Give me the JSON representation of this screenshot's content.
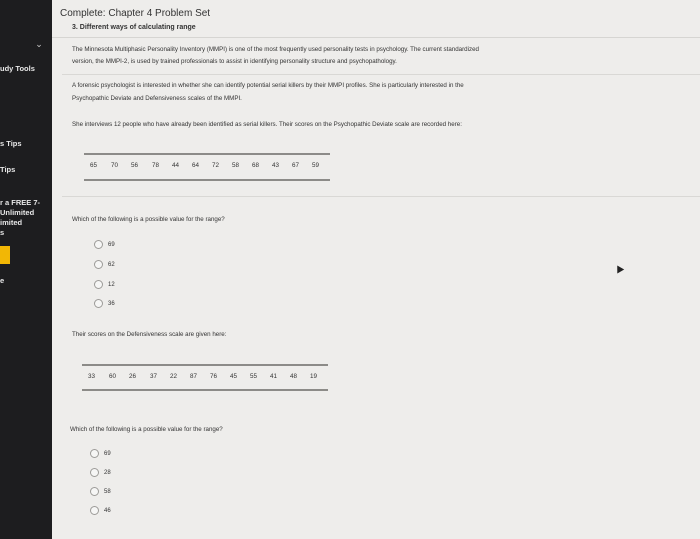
{
  "sidebar": {
    "items": [
      {
        "label": "udy Tools"
      },
      {
        "label": "s Tips"
      },
      {
        "label": "Tips"
      },
      {
        "label": "r a FREE 7-"
      },
      {
        "label": "Unlimited"
      },
      {
        "label": "imited"
      },
      {
        "label": "s"
      },
      {
        "label": "e"
      }
    ]
  },
  "header": {
    "title": "Complete: Chapter 4 Problem Set",
    "subtitle": "3. Different ways of calculating range"
  },
  "intro": {
    "p1_line1": "The Minnesota Multiphasic Personality Inventory (MMPI) is one of the most frequently used personality tests in psychology. The current standardized",
    "p1_line2": "version, the MMPI-2, is used by trained professionals to assist in identifying personality structure and psychopathology.",
    "p2_line1": "A forensic psychologist is interested in whether she can identify potential serial killers by their MMPI profiles. She is particularly interested in the",
    "p2_line2": "Psychopathic Deviate and Defensiveness scales of the MMPI.",
    "p3": "She interviews 12 people who have already been identified as serial killers. Their scores on the Psychopathic Deviate scale are recorded here:"
  },
  "pd_scores": [
    "65",
    "70",
    "56",
    "78",
    "44",
    "64",
    "72",
    "58",
    "68",
    "43",
    "67",
    "59"
  ],
  "q1": {
    "prompt": "Which of the following is a possible value for the range?",
    "options": [
      "69",
      "62",
      "12",
      "36"
    ]
  },
  "def_intro": "Their scores on the Defensiveness scale are given here:",
  "def_scores": [
    "33",
    "60",
    "26",
    "37",
    "22",
    "87",
    "76",
    "45",
    "55",
    "41",
    "48",
    "19"
  ],
  "q2": {
    "prompt": "Which of the following is a possible value for the range?",
    "options": [
      "69",
      "28",
      "58",
      "46"
    ]
  }
}
